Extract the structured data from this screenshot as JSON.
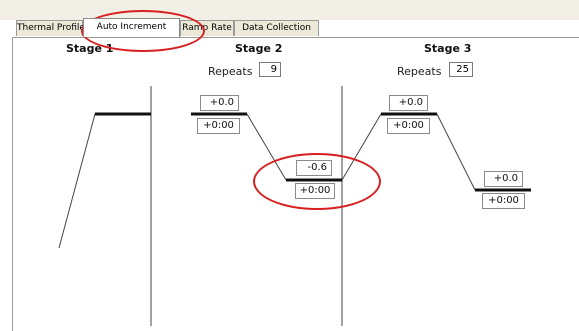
{
  "tabs": [
    {
      "label": "Thermal Profile"
    },
    {
      "label": "Auto Increment"
    },
    {
      "label": "Ramp Rate"
    },
    {
      "label": "Data Collection"
    }
  ],
  "active_tab": "Auto Increment",
  "stages": [
    {
      "title": "Stage 1"
    },
    {
      "title": "Stage 2",
      "repeats_label": "Repeats",
      "repeats_value": "9"
    },
    {
      "title": "Stage 3",
      "repeats_label": "Repeats",
      "repeats_value": "25"
    }
  ],
  "steps": [
    {
      "temp_increment": "+0.0",
      "time_increment": "+0:00"
    },
    {
      "temp_increment": "-0.6",
      "time_increment": "+0:00"
    },
    {
      "temp_increment": "+0.0",
      "time_increment": "+0:00"
    },
    {
      "temp_increment": "+0.0",
      "time_increment": "+0:00"
    }
  ],
  "colors": {
    "highlight": "#d92020",
    "tab_bg": "#ece9d8"
  }
}
